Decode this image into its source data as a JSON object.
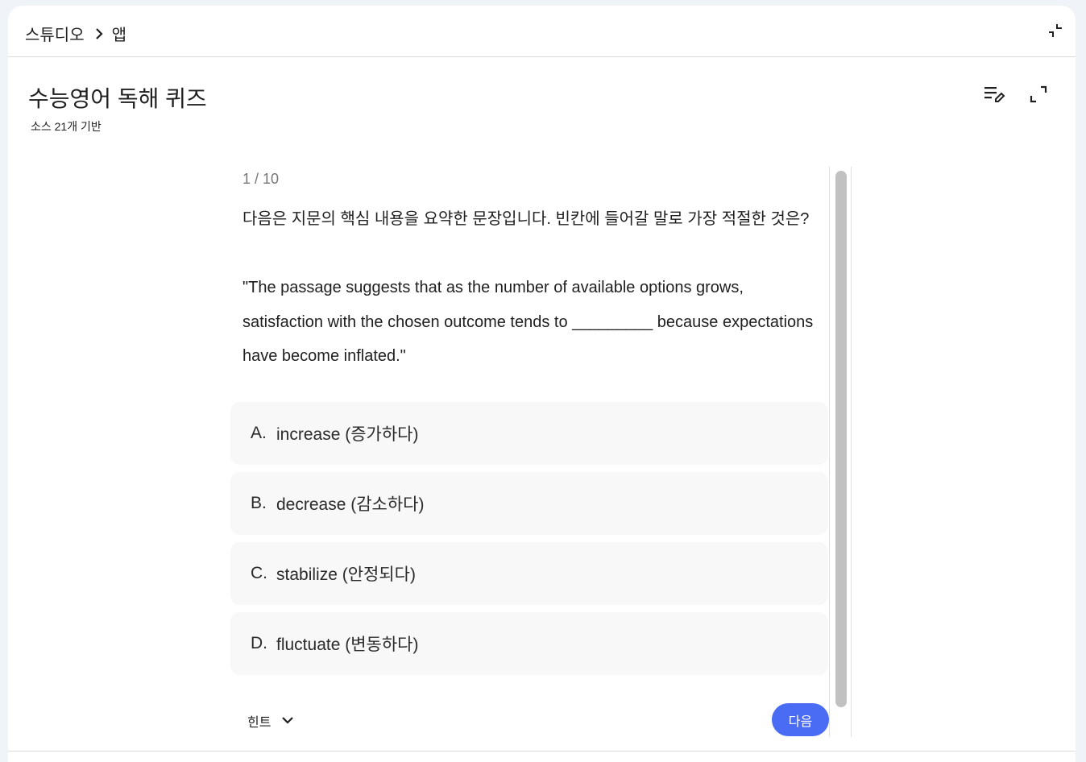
{
  "breadcrumb": {
    "root": "스튜디오",
    "current": "앱"
  },
  "header": {
    "title": "수능영어 독해 퀴즈",
    "subtitle": "소스 21개 기반"
  },
  "quiz": {
    "counter": "1 / 10",
    "question": "다음은 지문의 핵심 내용을 요약한 문장입니다. 빈칸에 들어갈 말로 가장 적절한 것은?\n\n\"The passage suggests that as the number of available options grows, satisfaction with the chosen outcome tends to _________ because expectations have become inflated.\"",
    "options": [
      {
        "letter": "A.",
        "text": "increase (증가하다)"
      },
      {
        "letter": "B.",
        "text": "decrease (감소하다)"
      },
      {
        "letter": "C.",
        "text": "stabilize (안정되다)"
      },
      {
        "letter": "D.",
        "text": "fluctuate (변동하다)"
      }
    ],
    "hint_label": "힌트",
    "next_label": "다음"
  },
  "icons": {
    "breadcrumb_separator": "chevron-right-icon",
    "collapse": "collapse-icon",
    "edit": "edit-list-icon",
    "expand": "fullscreen-icon",
    "hint_toggle": "chevron-down-icon"
  },
  "colors": {
    "accent": "#4a6cf5",
    "option_bg": "#f8f8f8",
    "page_bg": "#f0f4f9"
  }
}
